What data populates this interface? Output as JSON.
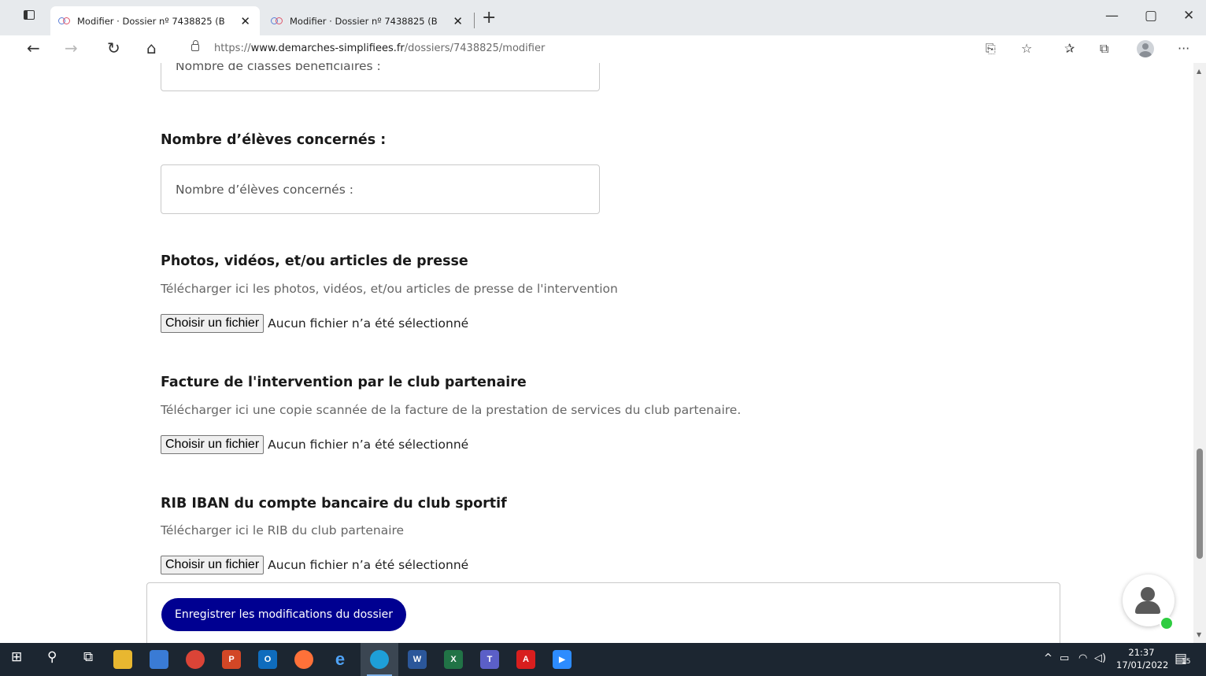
{
  "browser": {
    "tabs": [
      {
        "label": "Modifier · Dossier nº 7438825 (B",
        "active": true
      },
      {
        "label": "Modifier · Dossier nº 7438825 (B",
        "active": false
      }
    ],
    "close_glyph": "✕",
    "new_tab_glyph": "+",
    "window_controls": {
      "minimize": "—",
      "restore": "▢",
      "close": "✕"
    },
    "nav": {
      "back": "←",
      "forward": "→",
      "reload": "↻",
      "home": "⌂"
    },
    "url_prefix": "https://",
    "url_host": "www.demarches-simplifiees.fr",
    "url_path": "/dossiers/7438825/modifier",
    "toolbar_glyphs": {
      "read_aloud": "⎘",
      "favorite_add": "☆",
      "favorites": "✰",
      "collections": "⧉",
      "more": "···"
    }
  },
  "form": {
    "classes_placeholder": "Nombre de classes bénéficiaires :",
    "students": {
      "label": "Nombre d’élèves concernés :",
      "placeholder": "Nombre d’élèves concernés :"
    },
    "media": {
      "label": "Photos, vidéos, et/ou articles de presse",
      "description": "Télécharger ici les photos, vidéos, et/ou articles de presse de l'intervention",
      "button": "Choisir un fichier",
      "status": "Aucun fichier n’a été sélectionné"
    },
    "invoice": {
      "label": "Facture de l'intervention par le club partenaire",
      "description": "Télécharger ici une copie scannée de la facture de la prestation de services du club partenaire.",
      "button": "Choisir un fichier",
      "status": "Aucun fichier n’a été sélectionné"
    },
    "rib": {
      "label": "RIB IBAN du compte bancaire du club sportif",
      "description": "Télécharger ici le RIB du club partenaire",
      "button": "Choisir un fichier",
      "status": "Aucun fichier n’a été sélectionné"
    },
    "save_button": "Enregistrer les modifications du dossier"
  },
  "taskbar": {
    "apps": [
      {
        "name": "start-icon",
        "glyph": "⊞"
      },
      {
        "name": "search-icon",
        "glyph": "⚲"
      },
      {
        "name": "task-view-icon",
        "glyph": "⧉"
      },
      {
        "name": "file-explorer-icon",
        "glyph": ""
      },
      {
        "name": "remote-desktop-icon",
        "glyph": ""
      },
      {
        "name": "chrome-icon",
        "glyph": ""
      },
      {
        "name": "powerpoint-icon",
        "glyph": "P"
      },
      {
        "name": "outlook-icon",
        "glyph": "O"
      },
      {
        "name": "firefox-icon",
        "glyph": ""
      },
      {
        "name": "internet-explorer-icon",
        "glyph": "e"
      },
      {
        "name": "edge-icon",
        "glyph": ""
      },
      {
        "name": "word-icon",
        "glyph": "W"
      },
      {
        "name": "excel-icon",
        "glyph": "X"
      },
      {
        "name": "teams-icon",
        "glyph": "T"
      },
      {
        "name": "acrobat-icon",
        "glyph": "A"
      },
      {
        "name": "zoom-icon",
        "glyph": "▶"
      }
    ],
    "systray": {
      "chevron": "^",
      "battery": "▭",
      "network": "◠",
      "volume": "◁)"
    },
    "time": "21:37",
    "date": "17/01/2022",
    "notifications_count": "15"
  },
  "colors": {
    "primary": "#000091",
    "online": "#2ecc40",
    "taskbar": "#1c2631"
  }
}
